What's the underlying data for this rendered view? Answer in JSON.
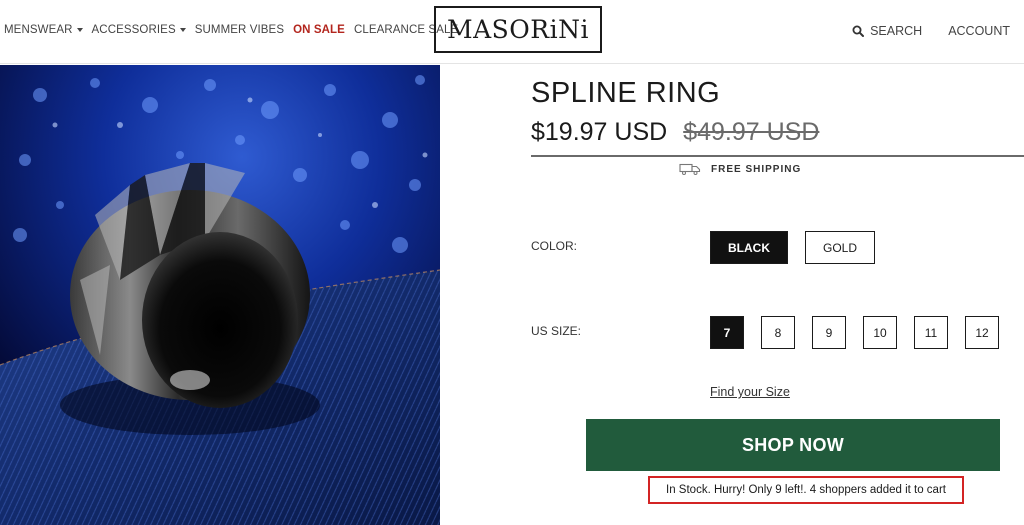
{
  "header": {
    "nav": [
      {
        "label": "MENSWEAR",
        "dropdown": true
      },
      {
        "label": "ACCESSORIES",
        "dropdown": true
      },
      {
        "label": "SUMMER VIBES",
        "dropdown": false
      },
      {
        "label": "ON SALE",
        "dropdown": false
      },
      {
        "label": "CLEARANCE SALE",
        "dropdown": false
      }
    ],
    "logo": "MASORiNi",
    "search_label": "SEARCH",
    "account_label": "ACCOUNT"
  },
  "product": {
    "image_icon": "black-ring-photo",
    "title": "SPLINE RING",
    "price": "$19.97 USD",
    "compare_price": "$49.97 USD",
    "shipping_label": "FREE SHIPPING",
    "color_label": "COLOR:",
    "colors": [
      "BLACK",
      "GOLD"
    ],
    "selected_color": "BLACK",
    "size_label": "US SIZE:",
    "sizes": [
      "7",
      "8",
      "9",
      "10",
      "11",
      "12"
    ],
    "selected_size": "7",
    "find_size_label": "Find your Size",
    "shop_now_label": "SHOP NOW",
    "stock_message": "In Stock. Hurry! Only 9 left!. 4 shoppers added it to cart"
  },
  "colors": {
    "sale_red": "#b3261e",
    "shop_button_green": "#215b3c",
    "highlight_red": "#d32424",
    "selected_black": "#111111"
  }
}
